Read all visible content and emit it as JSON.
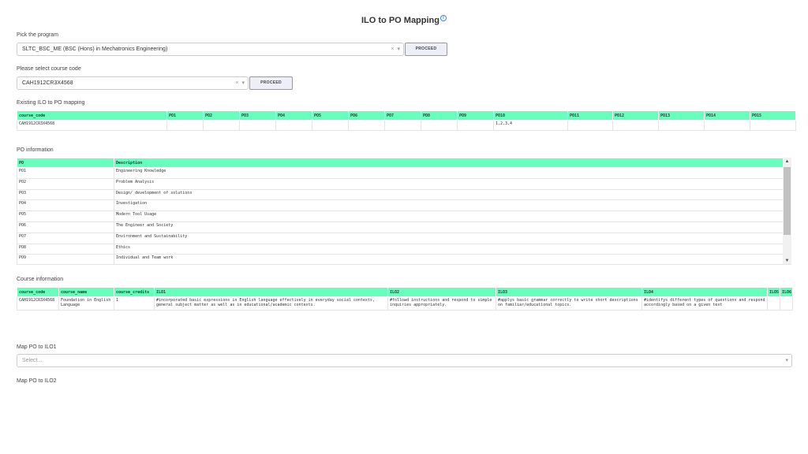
{
  "page": {
    "title": "ILO to PO Mapping",
    "info_icon": "info-icon"
  },
  "program": {
    "label": "Pick the program",
    "value": "SLTC_BSC_ME (BSC (Hons) in Mechatronics Engineering)",
    "button": "PROCEED"
  },
  "course": {
    "label": "Please select course code",
    "value": "CAH1912CR3X4568",
    "button": "PROCEED"
  },
  "existing": {
    "label": "Existing ILO to PO mapping",
    "headers": [
      "course_code",
      "PO1",
      "PO2",
      "PO3",
      "PO4",
      "PO5",
      "PO6",
      "PO7",
      "PO8",
      "PO9",
      "PO10",
      "PO11",
      "PO12",
      "PO13",
      "PO14",
      "PO15"
    ],
    "row": [
      "CAH1912CR3X4568",
      "",
      "",
      "",
      "",
      "",
      "",
      "",
      "",
      "",
      "1,2,3,4",
      "",
      "",
      "",
      "",
      ""
    ]
  },
  "po_info": {
    "label": "PO information",
    "headers": [
      "PO",
      "Description"
    ],
    "rows": [
      [
        "PO1",
        "Engineering Knowledge"
      ],
      [
        "PO2",
        "Problem Analysis"
      ],
      [
        "PO3",
        "Design/ development of solutions"
      ],
      [
        "PO4",
        "Investigation"
      ],
      [
        "PO5",
        "Modern Tool Usage"
      ],
      [
        "PO6",
        "The Engineer and Society"
      ],
      [
        "PO7",
        "Environment and Sustainability"
      ],
      [
        "PO8",
        "Ethics"
      ],
      [
        "PO9",
        "Individual and Team work"
      ]
    ]
  },
  "course_info": {
    "label": "Course information",
    "headers": [
      "course_code",
      "course_name",
      "course_credits",
      "ILO1",
      "ILO2",
      "ILO3",
      "ILO4",
      "ILO5",
      "ILO6"
    ],
    "row": [
      "CAH1912CR3X4568",
      "Foundation in English Language",
      "1",
      "#incorporated basic expressions in English language effectively in everyday social contexts, general subject matter as well as in educational/academic contexts.",
      "#followd instructions and respond to simple inquiries appropriately.",
      "#applys basic grammar correctly to write short descriptions on familiar/educational topics.",
      "#identifys different types of questions and respond accordingly based on a given text",
      "",
      ""
    ]
  },
  "map1": {
    "label": "Map PO to ILO1",
    "placeholder": "Select..."
  },
  "map2": {
    "label": "Map PO to ILO2"
  }
}
